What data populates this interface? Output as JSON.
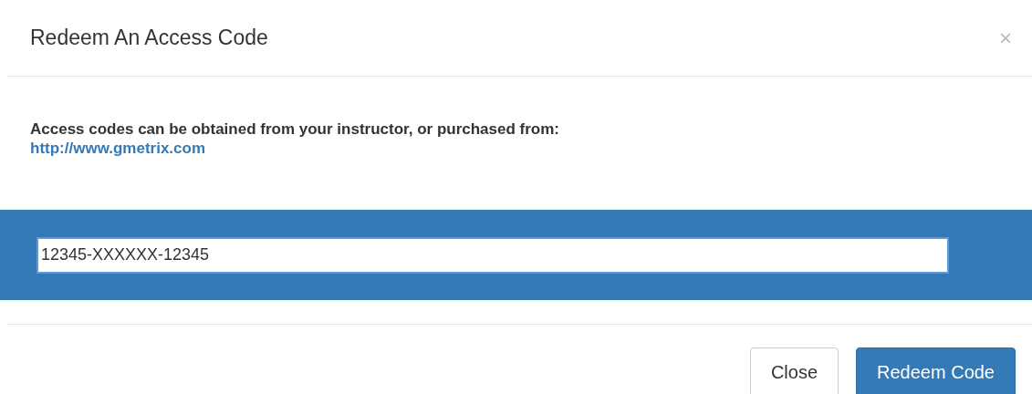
{
  "dialog": {
    "title": "Redeem An Access Code",
    "close_glyph": "×"
  },
  "body": {
    "message": "Access codes can be obtained from your instructor, or purchased from:",
    "link": "http://www.gmetrix.com"
  },
  "code_field": {
    "value": "12345-XXXXXX-12345"
  },
  "buttons": [
    {
      "label": "Close",
      "kind": "default"
    },
    {
      "label": "Redeem Code",
      "kind": "primary"
    }
  ]
}
